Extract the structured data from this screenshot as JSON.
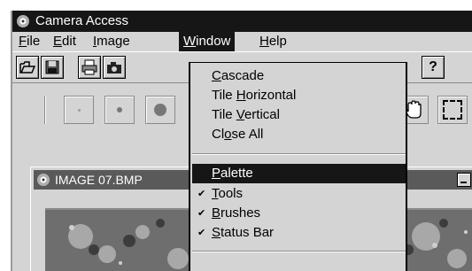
{
  "window": {
    "title": "Camera Access"
  },
  "menubar": {
    "items": [
      {
        "label_accel": "F",
        "label_rest": "ile"
      },
      {
        "label_accel": "E",
        "label_rest": "dit"
      },
      {
        "label_accel": "I",
        "label_rest": "mage"
      },
      {
        "label_accel": "W",
        "label_rest": "indow"
      },
      {
        "label_accel": "H",
        "label_rest": "elp"
      }
    ],
    "active": "Window"
  },
  "window_menu": {
    "items": [
      {
        "pre": "",
        "accel": "C",
        "post": "ascade",
        "checked": false
      },
      {
        "pre": "Tile ",
        "accel": "H",
        "post": "orizontal",
        "checked": false
      },
      {
        "pre": "Tile ",
        "accel": "V",
        "post": "ertical",
        "checked": false
      },
      {
        "pre": "Cl",
        "accel": "o",
        "post": "se All",
        "checked": false
      },
      {
        "pre": "",
        "accel": "P",
        "post": "alette",
        "checked": false,
        "highlighted": true
      },
      {
        "pre": "",
        "accel": "T",
        "post": "ools",
        "checked": true
      },
      {
        "pre": "",
        "accel": "B",
        "post": "rushes",
        "checked": true
      },
      {
        "pre": "",
        "accel": "S",
        "post": "tatus Bar",
        "checked": true
      }
    ]
  },
  "toolbar": {
    "icons": [
      "open-folder-icon",
      "save-disk-icon",
      "print-icon",
      "camera-icon",
      "help-icon"
    ],
    "help_glyph": "?"
  },
  "brushes": {
    "icons": [
      "brush-tiny-icon",
      "brush-small-icon",
      "brush-medium-icon",
      "hand-icon",
      "marquee-select-icon"
    ]
  },
  "child_window": {
    "title": "IMAGE 07.BMP"
  },
  "colors": {
    "title_bar": "#161616",
    "highlight": "#161616",
    "face": "#d4d4d4",
    "child_title": "#5a5a5a"
  }
}
